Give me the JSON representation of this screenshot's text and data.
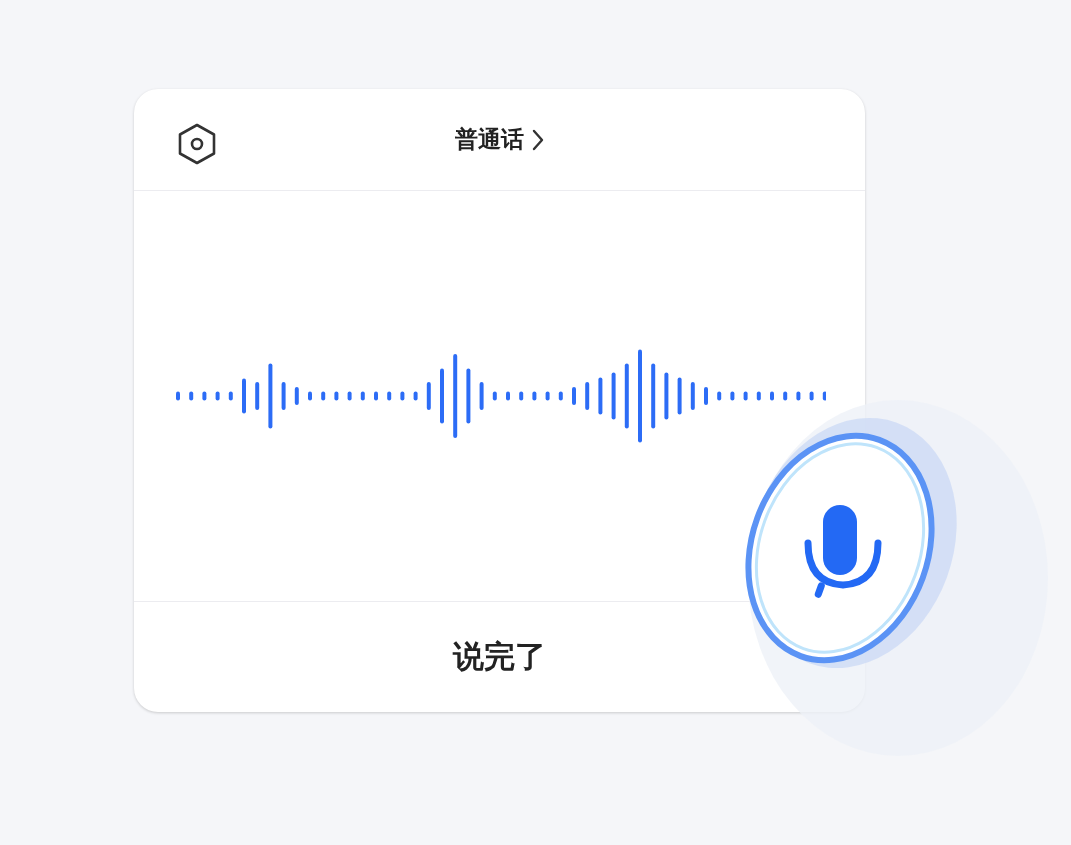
{
  "header": {
    "language": "普通话"
  },
  "footer": {
    "done_button": "说完了"
  }
}
